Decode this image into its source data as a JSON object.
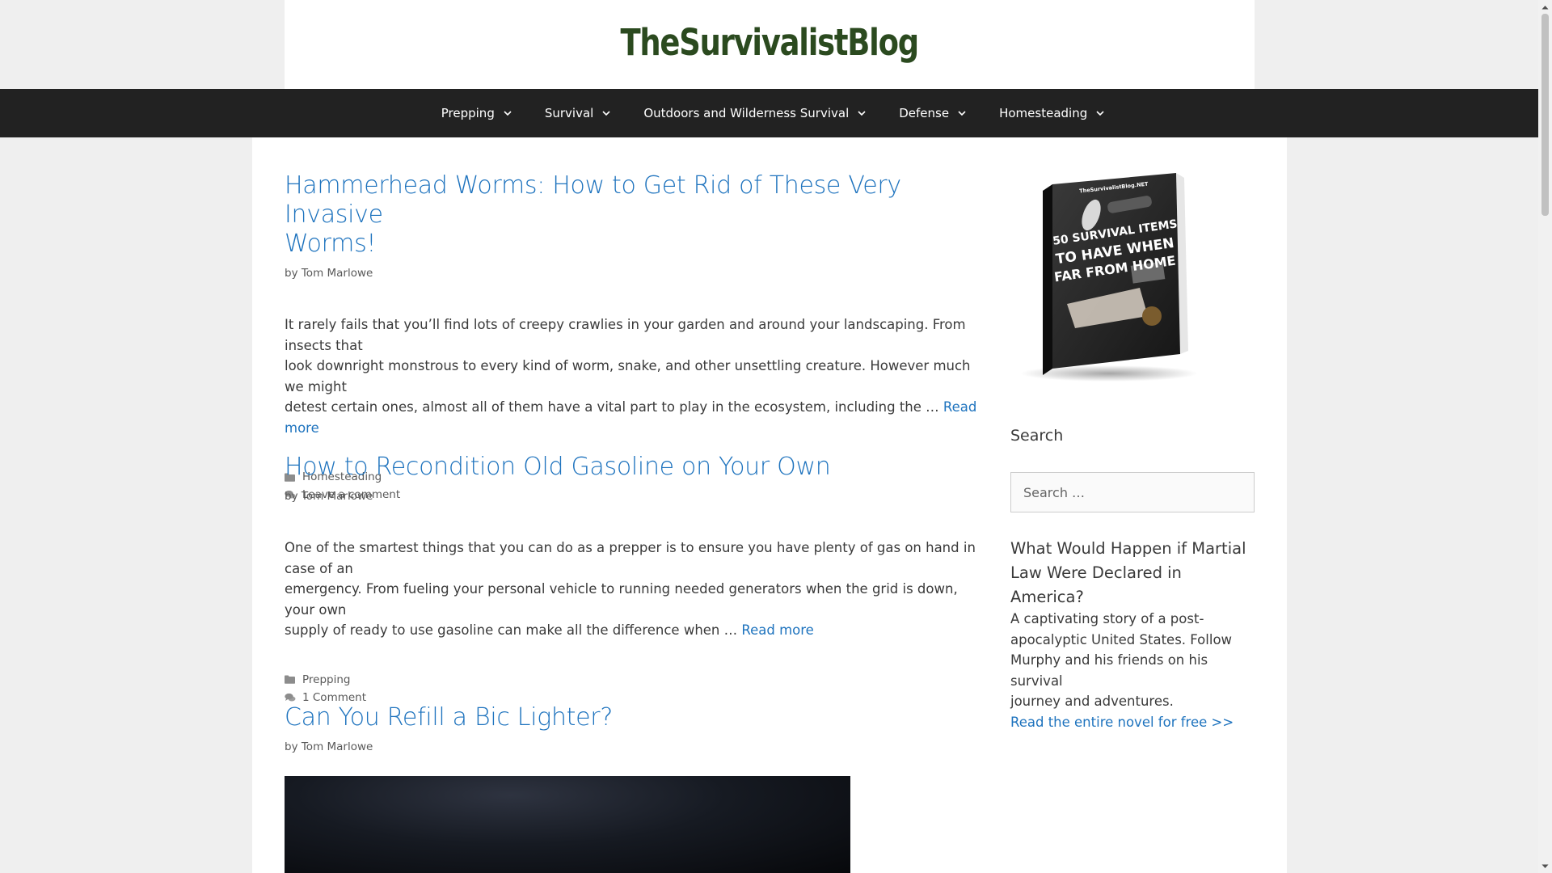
{
  "site": {
    "title": "TheSurvivalistBlog"
  },
  "nav": {
    "items": [
      {
        "label": "Prepping"
      },
      {
        "label": "Survival"
      },
      {
        "label": "Outdoors and Wilderness Survival"
      },
      {
        "label": "Defense"
      },
      {
        "label": "Homesteading"
      }
    ]
  },
  "posts": [
    {
      "title_line1": "Hammerhead Worms: How to Get Rid of These Very Invasive",
      "title_line2": "Worms!",
      "byline_prefix": "by",
      "author": "Tom Marlowe",
      "excerpt_lines": [
        "It rarely fails that you’ll find lots of creepy crawlies in your garden and around your landscaping. From insects that",
        "look downright monstrous to every kind of worm, snake, and other unsettling creature. However much we might",
        "detest certain ones, almost all of them have a vital part to play in the ecosystem, including the …"
      ],
      "read_more": "Read more",
      "category": "Homesteading",
      "comments": "Leave a comment"
    },
    {
      "title_line1": "How to Recondition Old Gasoline on Your Own",
      "byline_prefix": "by",
      "author": "Tom Marlowe",
      "excerpt_lines": [
        "One of the smartest things that you can do as a prepper is to ensure you have plenty of gas on hand in case of an",
        "emergency. From fueling your personal vehicle to running needed generators when the grid is down, your own",
        "supply of ready to use gasoline can make all the difference when …"
      ],
      "read_more": "Read more",
      "category": "Prepping",
      "comments": "1 Comment"
    },
    {
      "title_line1": "Can You Refill a Bic Lighter?",
      "byline_prefix": "by",
      "author": "Tom Marlowe"
    }
  ],
  "sidebar": {
    "book": {
      "brand": "TheSurvivalistBlog.NET",
      "line1": "50 SURVIVAL ITEMS",
      "line2": "TO HAVE WHEN",
      "line3": "FAR FROM HOME"
    },
    "search_title": "Search",
    "search_placeholder": "Search …",
    "promo_heading_line1": "What Would Happen if Martial",
    "promo_heading_line2": "Law Were Declared in America?",
    "promo_text_lines": [
      "A captivating story of a post-",
      "apocalyptic United States. Follow",
      "Murphy and his friends on his survival",
      "journey and adventures."
    ],
    "promo_link": "Read the entire novel for free >>"
  },
  "colors": {
    "title_green": "#2b4a1f",
    "nav_bg": "#222222",
    "link_blue": "#1e73be",
    "page_bg": "#efefef"
  }
}
